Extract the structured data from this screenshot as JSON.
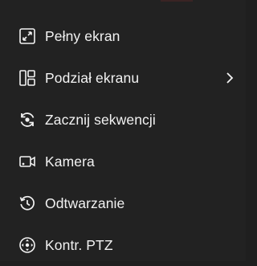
{
  "menu": {
    "items": [
      {
        "label": "Pełny ekran",
        "icon": "fullscreen-icon",
        "has_submenu": false
      },
      {
        "label": "Podział ekranu",
        "icon": "split-screen-icon",
        "has_submenu": true
      },
      {
        "label": "Zacznij sekwencji",
        "icon": "sequence-icon",
        "has_submenu": false
      },
      {
        "label": "Kamera",
        "icon": "camera-icon",
        "has_submenu": false
      },
      {
        "label": "Odtwarzanie",
        "icon": "playback-icon",
        "has_submenu": false
      },
      {
        "label": "Kontr. PTZ",
        "icon": "ptz-control-icon",
        "has_submenu": false
      }
    ]
  },
  "colors": {
    "background": "#222222",
    "text": "#f2f2f2",
    "icon": "#f2f2f2"
  }
}
